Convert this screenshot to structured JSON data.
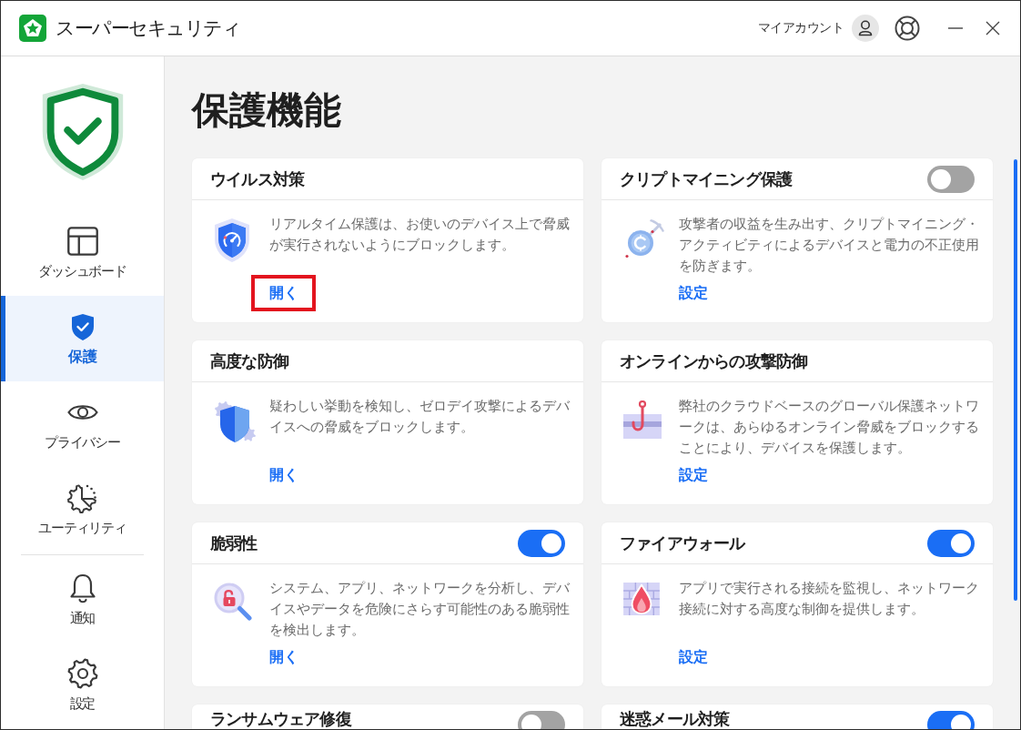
{
  "window": {
    "title": "スーパーセキュリティ",
    "account_label": "マイアカウント"
  },
  "sidebar": {
    "items": [
      {
        "label": "ダッシュボード",
        "kind": "dashboard",
        "selected": false
      },
      {
        "label": "保護",
        "kind": "protection",
        "selected": true
      },
      {
        "label": "プライバシー",
        "kind": "privacy",
        "selected": false
      },
      {
        "label": "ユーティリティ",
        "kind": "utilities",
        "selected": false
      }
    ],
    "footer_items": [
      {
        "label": "通知",
        "kind": "notifications",
        "selected": false
      },
      {
        "label": "設定",
        "kind": "settings",
        "selected": false
      }
    ]
  },
  "page": {
    "title": "保護機能"
  },
  "cards": [
    {
      "title": "ウイルス対策",
      "kind": "virus",
      "description": "リアルタイム保護は、お使いのデバイス上で脅威が実行されないようにブロックします。",
      "link": {
        "label": "開く",
        "highlighted": true
      }
    },
    {
      "title": "クリプトマイニング保護",
      "toggle": {
        "on": false
      },
      "kind": "crypto",
      "description": "攻撃者の収益を生み出す、クリプトマイニング・アクティビティによるデバイスと電力の不正使用を防ぎます。",
      "link": {
        "label": "設定",
        "highlighted": false
      }
    },
    {
      "title": "高度な防御",
      "kind": "advanced",
      "description": "疑わしい挙動を検知し、ゼロデイ攻撃によるデバイスへの脅威をブロックします。",
      "link": {
        "label": "開く",
        "highlighted": false
      }
    },
    {
      "title": "オンラインからの攻撃防御",
      "kind": "online",
      "description": "弊社のクラウドベースのグローバル保護ネットワークは、あらゆるオンライン脅威をブロックすることにより、デバイスを保護します。",
      "link": {
        "label": "設定",
        "highlighted": false
      }
    },
    {
      "title": "脆弱性",
      "toggle": {
        "on": true
      },
      "kind": "vulnerability",
      "description": "システム、アプリ、ネットワークを分析し、デバイスやデータを危険にさらす可能性のある脆弱性を検出します。",
      "link": {
        "label": "開く",
        "highlighted": false
      }
    },
    {
      "title": "ファイアウォール",
      "toggle": {
        "on": true
      },
      "kind": "firewall",
      "description": "アプリで実行される接続を監視し、ネットワーク接続に対する高度な制御を提供します。",
      "link": {
        "label": "設定",
        "highlighted": false
      }
    },
    {
      "title": "ランサムウェア修復",
      "toggle": {
        "on": false
      }
    },
    {
      "title": "迷惑メール対策",
      "toggle": {
        "on": true
      }
    }
  ]
}
